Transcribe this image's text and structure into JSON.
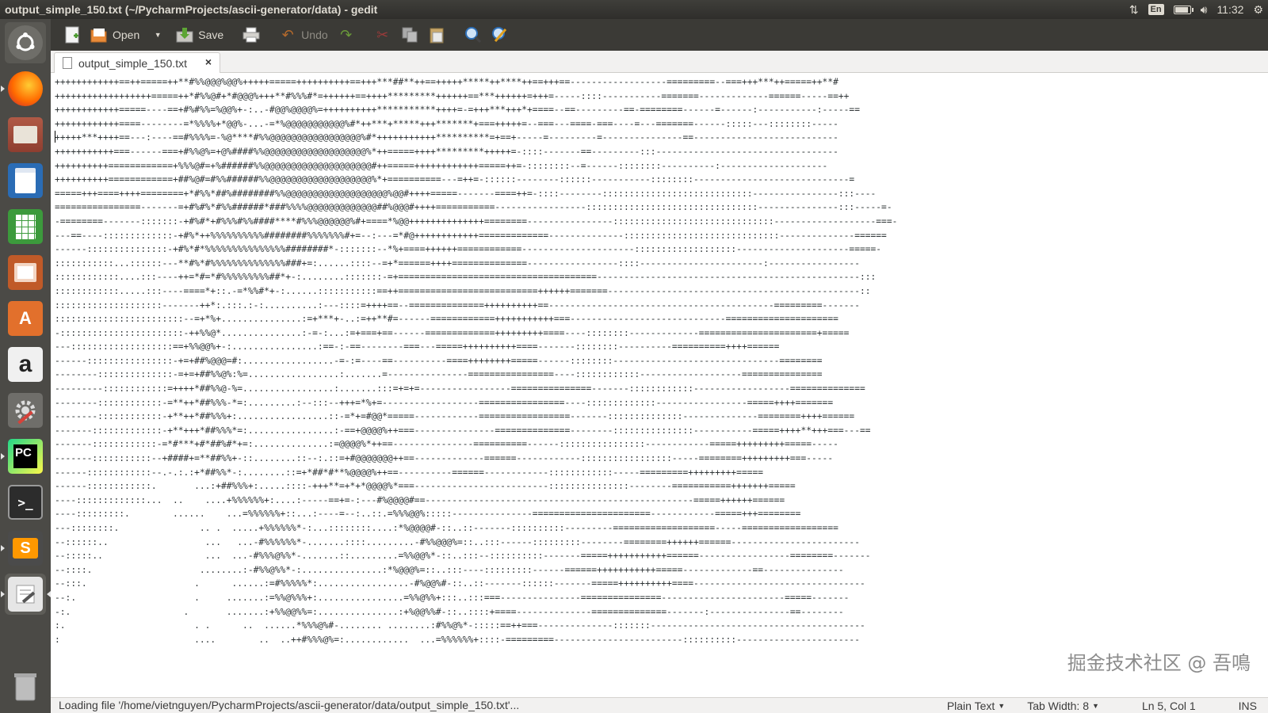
{
  "window": {
    "title": "output_simple_150.txt (~/PycharmProjects/ascii-generator/data) - gedit"
  },
  "top_panel": {
    "lang": "En",
    "time": "11:32"
  },
  "launcher": [
    {
      "name": "dash-home-icon",
      "label": ""
    },
    {
      "name": "firefox-icon",
      "label": ""
    },
    {
      "name": "files-icon",
      "label": ""
    },
    {
      "name": "writer-icon",
      "label": ""
    },
    {
      "name": "calc-icon",
      "label": ""
    },
    {
      "name": "impress-icon",
      "label": ""
    },
    {
      "name": "software-center-icon",
      "label": ""
    },
    {
      "name": "amazon-icon",
      "label": "a"
    },
    {
      "name": "system-settings-icon",
      "label": ""
    },
    {
      "name": "pycharm-icon",
      "label": "PC"
    },
    {
      "name": "terminal-icon",
      "label": ">_"
    },
    {
      "name": "sublime-icon",
      "label": "S"
    },
    {
      "name": "text-editor-icon",
      "label": ""
    },
    {
      "name": "trash-icon",
      "label": ""
    }
  ],
  "toolbar": {
    "open_label": "Open",
    "save_label": "Save",
    "undo_label": "Undo"
  },
  "tab": {
    "filename": "output_simple_150.txt",
    "close": "×"
  },
  "editor": {
    "lines": [
      "++++++++++++==++=====++**#%%@@@%@@%+++++=====++++++++++==+++***##**++==+++++*****++****++==+++==------------------=========--===+++***++=====++**#",
      "++++++++++++++++++=====++*#%%@#+*#@@@%+++**#%%%#*=++++++==++++*********++++++==***++++++=+++=-----::::-----------=======-------------======-----==++",
      "++++++++++++=====----==+#%#%%=%@@%+-:..-#@@%@@@@%=++++++++++***********++++=-=+++***+++*+====--==---------==-========------=------:-----------:-----==",
      "++++++++++++====--------=*%%%%+*@@%-...-=*%@@@@@@@@@@@%#*++***+*****+++*******+===+++++=--===---====-===----=---=======------:::::---::::::::-----",
      "+++++***++++==---:----==#%%%%=-%@****#%%@@@@@@@@@@@@@@@@@%#*+++++++++++**********=+==+-----=---------=---------------==---------------------------",
      "+++++++++++===------===+#%%@%=+@%####%%@@@@@@@@@@@@@@@@@@@%*++=====++++*********+++++=-::::-------==---------:::----------------------------------",
      "++++++++++============+%%%@#=+%######%%@@@@@@@@@@@@@@@@@@@@#++=====++++++++++++=====++=-::::::::--=------::::::::----------:--------------------",
      "++++++++++============+##%@#=#%%######%%@@@@@@@@@@@@@@@@@@@%*+==========---=++=-::::::--------::::::-----------::::::::-----------------------------=",
      "=====+++====++++========+*#%%*##%########%%@@@@@@@@@@@@@@@@@@@%@@#++++=====-------====++=-::::--------::::::::::::::::::::::::::::----------------:::----",
      "================-------=+#%#%*#%%######*###%%%%@@@@@@@@@@@@@##%@@@#++++===========-----------------::::::::::::::::::::::::::::::::---------------:::-----=-",
      "-========-------:::::::-+#%#*+#%%%#%%####****#%%%@@@@@@%#+====*%@@++++++++++++++========----------------::::::::::::::::::::::::::::::-------------------===-",
      "---==----:::::::::::::-+#%*++%%%%%%%%%%########%%%%%%%#+=--:---=*#@++++++++++++=============--------------:::::::::::::::::::::::::::::--------------======",
      "------:::::::::::::::-+#%*#*%%%%%%%%%%%%%%%########*-:::::::--*%+====++++++============---------------------:::::::::::::::::::---------------------=====-",
      ":::::::::::...::::::---**#%*#%%%%%%%%%%%%%%###+=:......::::--=+*======++++==============-----------------::::-----------------------:-----------------",
      "::::::::::::....:::----++=*#=*#%%%%%%%%%##*+-:........:::::::-=+=====================================-------------------------------------------------:::",
      "::::::::::::.....:::----====*+::.-=*%%#*+-:......:::::::::::==++==========================++++++=======-----------------------------------------------::",
      "::::::::::::::::::::-------++*:.:::.:-:..........:---::::=++++==--==============++++++++++==------------------------------------------=========-------",
      "::::::::::::::::::::::::--=+*%+...............:=+***+-..:=++**#=------============+++++++++++===-----------------------------=====================",
      "-:::::::::::::::::::::::-++%%@*...............:-=-:...:=+===+==------=============+++++++++====----::::::::-------------======================+=====",
      "---:::::::::::::::::::==+%%@@%+-:................:==-:-==--------===---=====++++++++++====-------::::::::----------==========++++======",
      "------::::::::::::::::-+=+##%@@@=#:.................-=-:=----==----------====++++++++=====------::::::::-------------------------------========",
      "--------::::::::::::::-=+=+##%%@%:%=.................:.......=---------------================----::::::::::::-------------------===============",
      "---------::::::::::::=++++*##%%@-%=.................:.......:::=+=+=-----------------===============-------::::::::::::------------------==============",
      "--------::::::::::::-=**++*##%%%-*=:.........:--:::--+++=*%+=------------------================----:::::::::::::-----------------=====++++=======",
      "--------::::::::::::-+**++*##%%%+:.................::-=*+=#@@*=====------------=================-------::::::::::::::--------------========++++======",
      "-------:::::::::::::-+**+++*##%%%*=:................:-==+@@@@%++===---------------==============--------:::::::::::::::-----------=====++++**+++===---==",
      "-------::::::::::::-=*#***+#*##%#*+=:..............:=@@@@%*++==---------------==========------::::::::::::::::------------=====+++++++++=====-----",
      "-------:::::::::::--+####+=**##%%+-::........::--:.::=+#@@@@@@@++==-------------======------------:::::::::::::::::-----========+++++++++===-----",
      "------::::::::::::--.-.:.:+*##%%*-:........::=+*##*#**%@@@@%++==----------======------------::::::::::::-----=========+++++++++=====",
      "------::::::::::::.       ...:+##%%%+:.....::::-+++**=+*+*@@@@%*===-------------------------:::::::::::::::--------===========+++++++=====",
      "----:::::::::::::...  ..    ....+%%%%%%+:....:-----==+=-:---#%@@@@#==--------------------------------------------------=====++++++======",
      "----:::::::::.        ......    ...=%%%%%%+::...:----=--:..::.=%%%@@%:::::---------------======================------------=====+++========",
      "---::::::::.               .. .  .....+%%%%%%*-:...::::::::....:*%@@@@#-::..::-------::::::::::---------===================-----==================",
      "--::::::..                  ...   ...-#%%%%%%*-.......::::.........-#%%@@@%=::..:::------:::::::::--------========++++++======------------------------",
      "--:::::..                   ...  ...-#%%%@%%*-.......::.........=%%@@%*-::..:::--::::::::::-------=====+++++++++++======-----------------========-------",
      "--::::.                    ........:-#%%@%%*-:...............:*%@@@%=::..:::----:::::::::------======+++++++++++=====-------------==---------------",
      "--:::.                    .      ......:=#%%%%%*:.................-#%@@%#-::..::-------::::::-------=====++++++++++====--------------------------------",
      "--:.                      .     .......:=%%@%%%+:................=%%@%%+:::..:::===---------------===============-----------------------=====-------",
      "-:.                     .       .......:+%%@@%%=:...............:+%@@%%#-::..::::+====--------------==============-------:---------------==--------",
      ":.                        . .      ..  ......*%%%@%#-........ ........:#%%@%*-:::::==++===--------------:::::::----------------------------------------",
      ":                         ....        ..  ..++#%%%@%=:............  ...=%%%%%%+::::-=========------------------------::::::::::-----------------------"
    ]
  },
  "watermark": "掘金技术社区 @ 吾鳴",
  "statusbar": {
    "message": "Loading file '/home/vietnguyen/PycharmProjects/ascii-generator/data/output_simple_150.txt'...",
    "language": "Plain Text",
    "tab_width": "Tab Width: 8",
    "position": "Ln 5, Col 1",
    "mode": "INS"
  }
}
